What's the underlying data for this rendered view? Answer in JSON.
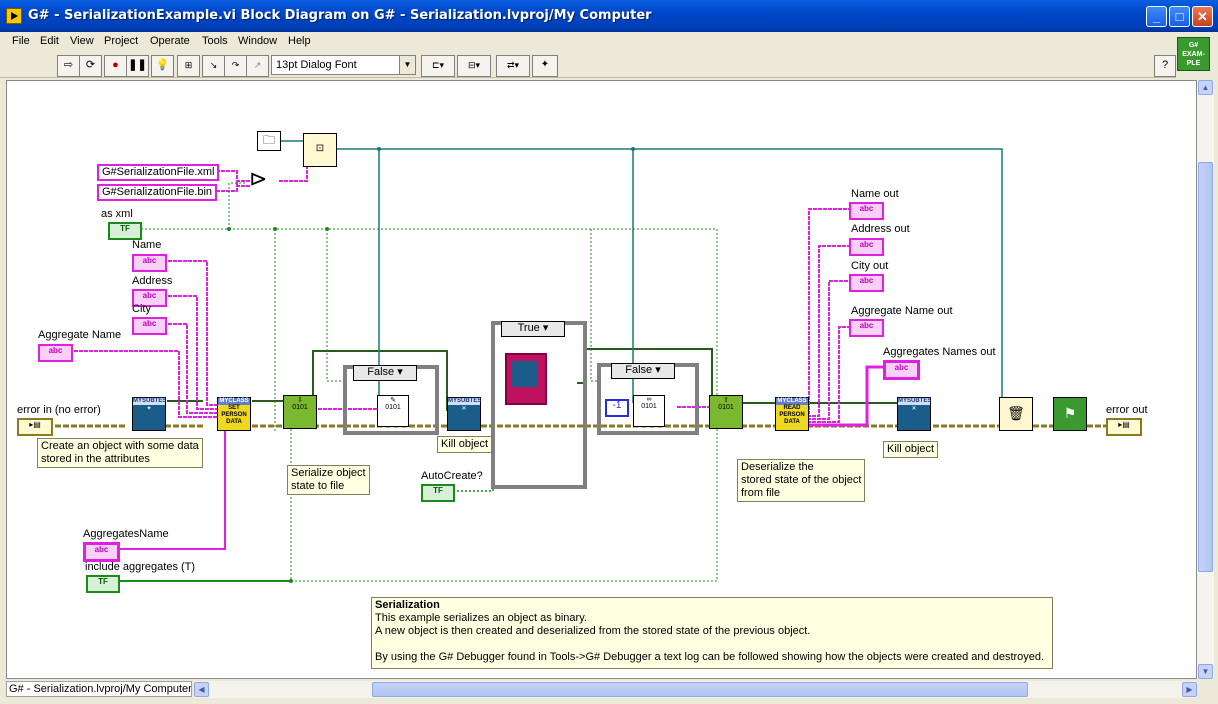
{
  "window": {
    "title": "G# - SerializationExample.vi Block Diagram on G# - Serialization.lvproj/My Computer",
    "buttons": {
      "minimize": "_",
      "maximize": "□",
      "close": "✕"
    }
  },
  "menu": [
    "File",
    "Edit",
    "View",
    "Project",
    "Operate",
    "Tools",
    "Window",
    "Help"
  ],
  "toolbar": {
    "font": "13pt Dialog Font",
    "gsharp_icon": "G# EXAM-PLE",
    "help": "?"
  },
  "diagram": {
    "string_constants": [
      "G#SerializationFile.xml",
      "G#SerializationFile.bin"
    ],
    "controls": {
      "as_xml": "as xml",
      "name": "Name",
      "address": "Address",
      "city": "City",
      "aggregate_name": "Aggregate Name",
      "error_in": "error in (no error)",
      "aggregates_name": "AggregatesName",
      "include_aggregates": "include aggregates (T)",
      "auto_create": "AutoCreate?"
    },
    "indicators": {
      "name_out": "Name out",
      "address_out": "Address out",
      "city_out": "City out",
      "aggregate_name_out": "Aggregate Name out",
      "aggregates_names_out": "Aggregates Names out",
      "error_out": "error out"
    },
    "terminal_glyphs": {
      "string": "abc",
      "bool": "TF",
      "error": "▸▤"
    },
    "case_selectors": [
      "False",
      "True",
      "False"
    ],
    "numeric_const": "-1",
    "vi_labels": {
      "mysubtes": "MYSUBTES",
      "myclass": "MYCLASS",
      "set_person_data": "SET PERSON DATA",
      "read_person_data": "READ PERSON DATA",
      "binary": "0101"
    },
    "notes": {
      "create": [
        "Create an object with some data",
        "stored in the attributes"
      ],
      "serialize": [
        "Serialize object",
        "state to file"
      ],
      "kill1": "Kill object",
      "deserialize": [
        "Deserialize the",
        "stored state of the object",
        "from file"
      ],
      "kill2": "Kill object"
    },
    "comment": {
      "title": "Serialization",
      "lines": [
        "This example serializes an object as binary.",
        "A new object is then created and deserialized from the stored state of the previous object.",
        "",
        "By using the G# Debugger found in Tools->G# Debugger a text log can be followed showing how the objects were created and destroyed."
      ]
    }
  },
  "status": {
    "project": "G# - Serialization.lvproj/My Computer"
  },
  "colors": {
    "error_wire": "#8a7a20",
    "string_wire": "#e020e0",
    "bool_wire": "#1a8a1a",
    "ref_wire": "#1a7a7a"
  }
}
